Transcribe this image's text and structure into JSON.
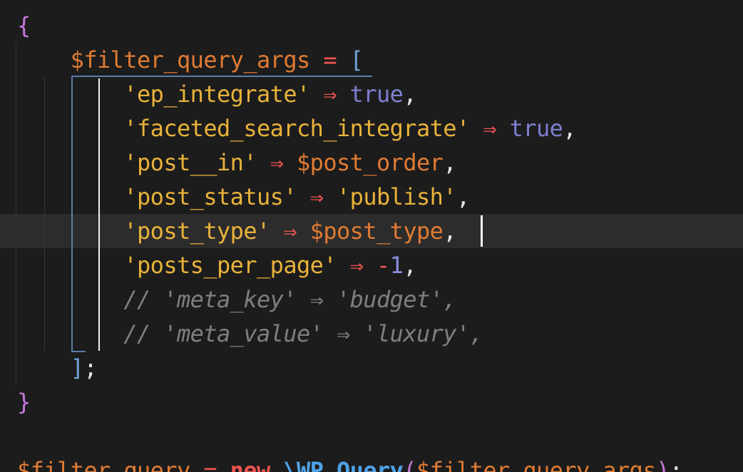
{
  "colors": {
    "background": "#1c1c1c",
    "current_line": "#2c2c2c",
    "brace": "#c678dd",
    "variable": "#e07b33",
    "operator": "#ef5350",
    "string": "#e8b23a",
    "keyword_value": "#7c7fd0",
    "number": "#8a8fe0",
    "punctuation": "#e6e6e6",
    "comment": "#7f7f7f",
    "bracket": "#6fa3d8",
    "keyword_new": "#ef5350",
    "class_name": "#4fa3e8"
  },
  "lines": [
    {
      "tokens": [
        {
          "text": "{",
          "kind": "brace"
        }
      ]
    },
    {
      "tokens": [
        {
          "text": "    ",
          "kind": "ws"
        },
        {
          "text": "$filter_query_args",
          "kind": "variable"
        },
        {
          "text": " ",
          "kind": "ws"
        },
        {
          "text": "=",
          "kind": "operator"
        },
        {
          "text": " ",
          "kind": "ws"
        },
        {
          "text": "[",
          "kind": "bracket"
        }
      ]
    },
    {
      "tokens": [
        {
          "text": "        ",
          "kind": "ws"
        },
        {
          "text": "'ep_integrate'",
          "kind": "string"
        },
        {
          "text": " ",
          "kind": "ws"
        },
        {
          "text": "⇒",
          "kind": "operator"
        },
        {
          "text": " ",
          "kind": "ws"
        },
        {
          "text": "true",
          "kind": "keyword_value"
        },
        {
          "text": ",",
          "kind": "punctuation"
        }
      ]
    },
    {
      "tokens": [
        {
          "text": "        ",
          "kind": "ws"
        },
        {
          "text": "'faceted_search_integrate'",
          "kind": "string"
        },
        {
          "text": " ",
          "kind": "ws"
        },
        {
          "text": "⇒",
          "kind": "operator"
        },
        {
          "text": " ",
          "kind": "ws"
        },
        {
          "text": "true",
          "kind": "keyword_value"
        },
        {
          "text": ",",
          "kind": "punctuation"
        }
      ]
    },
    {
      "tokens": [
        {
          "text": "        ",
          "kind": "ws"
        },
        {
          "text": "'post__in'",
          "kind": "string"
        },
        {
          "text": " ",
          "kind": "ws"
        },
        {
          "text": "⇒",
          "kind": "operator"
        },
        {
          "text": " ",
          "kind": "ws"
        },
        {
          "text": "$post_order",
          "kind": "variable"
        },
        {
          "text": ",",
          "kind": "punctuation"
        }
      ]
    },
    {
      "tokens": [
        {
          "text": "        ",
          "kind": "ws"
        },
        {
          "text": "'post_status'",
          "kind": "string"
        },
        {
          "text": " ",
          "kind": "ws"
        },
        {
          "text": "⇒",
          "kind": "operator"
        },
        {
          "text": " ",
          "kind": "ws"
        },
        {
          "text": "'publish'",
          "kind": "string"
        },
        {
          "text": ",",
          "kind": "punctuation"
        }
      ]
    },
    {
      "tokens": [
        {
          "text": "        ",
          "kind": "ws"
        },
        {
          "text": "'post_type'",
          "kind": "string"
        },
        {
          "text": " ",
          "kind": "ws"
        },
        {
          "text": "⇒",
          "kind": "operator"
        },
        {
          "text": " ",
          "kind": "ws"
        },
        {
          "text": "$post_type",
          "kind": "variable"
        },
        {
          "text": ",",
          "kind": "punctuation"
        }
      ]
    },
    {
      "tokens": [
        {
          "text": "        ",
          "kind": "ws"
        },
        {
          "text": "'posts_per_page'",
          "kind": "string"
        },
        {
          "text": " ",
          "kind": "ws"
        },
        {
          "text": "⇒",
          "kind": "operator"
        },
        {
          "text": " ",
          "kind": "ws"
        },
        {
          "text": "-",
          "kind": "operator"
        },
        {
          "text": "1",
          "kind": "number"
        },
        {
          "text": ",",
          "kind": "punctuation"
        }
      ]
    },
    {
      "tokens": [
        {
          "text": "        ",
          "kind": "ws"
        },
        {
          "text": "// 'meta_key' ⇒ 'budget',",
          "kind": "comment"
        }
      ]
    },
    {
      "tokens": [
        {
          "text": "        ",
          "kind": "ws"
        },
        {
          "text": "// 'meta_value' ⇒ 'luxury',",
          "kind": "comment"
        }
      ]
    },
    {
      "tokens": [
        {
          "text": "    ",
          "kind": "ws"
        },
        {
          "text": "]",
          "kind": "bracket"
        },
        {
          "text": ";",
          "kind": "punctuation"
        }
      ]
    },
    {
      "tokens": [
        {
          "text": "}",
          "kind": "brace"
        }
      ]
    },
    {
      "tokens": []
    },
    {
      "tokens": [
        {
          "text": "$filter_query",
          "kind": "variable"
        },
        {
          "text": " ",
          "kind": "ws"
        },
        {
          "text": "=",
          "kind": "operator"
        },
        {
          "text": " ",
          "kind": "ws"
        },
        {
          "text": "new",
          "kind": "keyword_new"
        },
        {
          "text": " ",
          "kind": "ws"
        },
        {
          "text": "\\WP_Query",
          "kind": "class_name"
        },
        {
          "text": "(",
          "kind": "brace"
        },
        {
          "text": "$filter_query_args",
          "kind": "variable"
        },
        {
          "text": ")",
          "kind": "brace"
        },
        {
          "text": ";",
          "kind": "punctuation"
        }
      ]
    }
  ]
}
